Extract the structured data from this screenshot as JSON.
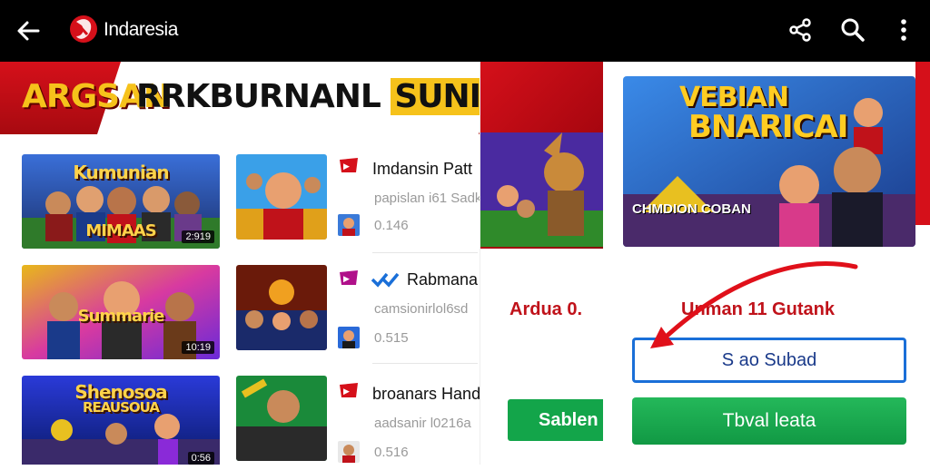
{
  "app": {
    "title": "Indaresia"
  },
  "toolbar": {
    "back_icon": "arrow-left-icon",
    "share_icon": "share-icon",
    "search_icon": "search-icon",
    "more_icon": "more-vertical-icon"
  },
  "banner": {
    "left_text": "ARGSAN",
    "right_text_a": "RRKBURNANL",
    "right_text_b": "SUNIMASK"
  },
  "list": {
    "items": [
      {
        "thumb_title": "Kumunian",
        "thumb_sub": "MIMAAS",
        "duration": "2:919",
        "title": "Imdansin Patt",
        "subtitle": "papislan i61 Sadk",
        "views": "0.146"
      },
      {
        "thumb_title": "Summarie",
        "thumb_sub": "",
        "duration": "10:19",
        "title": "Rabmana",
        "subtitle": "camsionirlol6sd",
        "views": "0.515"
      },
      {
        "thumb_title": "Shenosoa",
        "thumb_sub": "REAUSOUA",
        "duration": "0:56",
        "title": "broanars Hand",
        "subtitle": "aadsanir l0216a",
        "views": "0.516"
      }
    ]
  },
  "mid_panel": {
    "label": "Ardua 0.",
    "button_label": "Sablen L"
  },
  "right_panel": {
    "promo_title_1": "VEBIAN",
    "promo_title_2": "BNARICAI",
    "promo_badge": "CHMDION COBAN",
    "heading": "Unman 11 Gutank",
    "input_value": "S ao Subad",
    "button_label": "Tbval leata"
  },
  "colors": {
    "brand_red": "#d5101a",
    "accent_green": "#13a54a",
    "input_blue": "#1a6fd8"
  }
}
